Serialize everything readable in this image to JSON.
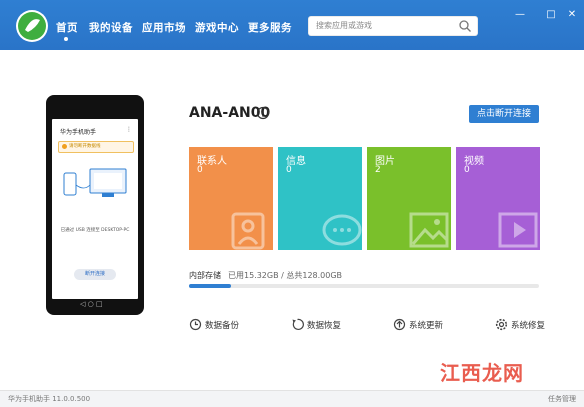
{
  "nav": {
    "items": [
      {
        "label": "首页"
      },
      {
        "label": "我的设备"
      },
      {
        "label": "应用市场"
      },
      {
        "label": "游戏中心"
      },
      {
        "label": "更多服务"
      }
    ]
  },
  "search": {
    "placeholder": "搜索应用或游戏"
  },
  "window": {
    "minimize": "—",
    "maximize": "□",
    "close": "✕"
  },
  "phone": {
    "app_title": "华为手机助手",
    "menu": "⋮",
    "warning": "请勿断开数据线",
    "connection": "已通过 USB 连接至 DESKTOP-PC",
    "button": "断开连接"
  },
  "device": {
    "name": "ANA-AN00",
    "disconnect_label": "点击断开连接"
  },
  "tiles": [
    {
      "label": "联系人",
      "count": "0",
      "color": "#f2904a"
    },
    {
      "label": "信息",
      "count": "0",
      "color": "#2fc2c6"
    },
    {
      "label": "图片",
      "count": "2",
      "color": "#7ac02b"
    },
    {
      "label": "视频",
      "count": "0",
      "color": "#a65fd6"
    }
  ],
  "storage": {
    "label": "内部存储",
    "value": "已用15.32GB / 总共128.00GB",
    "used_fraction": 0.12
  },
  "actions": [
    {
      "label": "数据备份",
      "icon": "clock-icon"
    },
    {
      "label": "数据恢复",
      "icon": "restore-icon"
    },
    {
      "label": "系统更新",
      "icon": "upload-icon"
    },
    {
      "label": "系统修复",
      "icon": "gear-icon"
    }
  ],
  "statusbar": {
    "version": "华为手机助手 11.0.0.500",
    "task_manager": "任务管理"
  },
  "watermark": "江西龙网"
}
